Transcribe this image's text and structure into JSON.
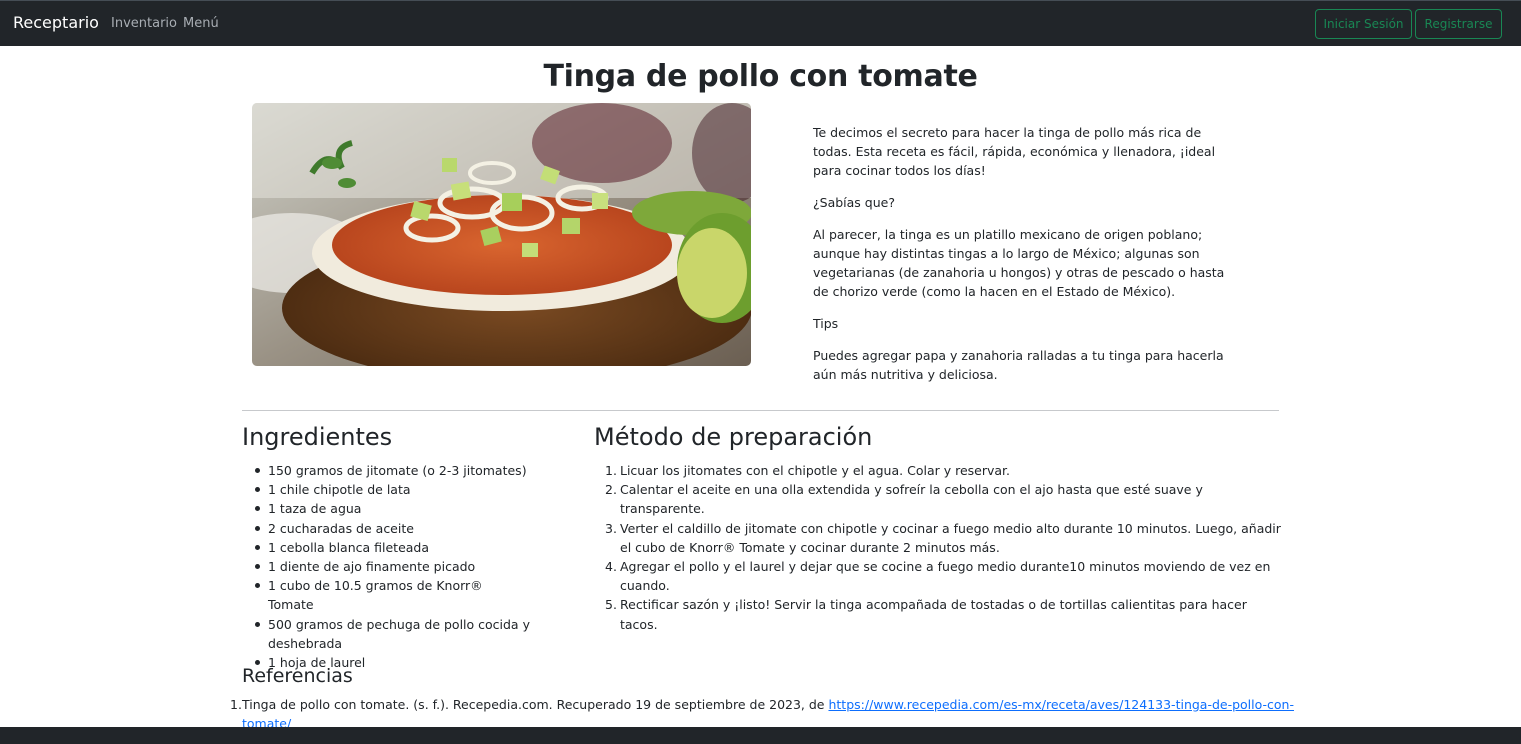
{
  "navbar": {
    "brand": "Receptario",
    "links": [
      "Inventario",
      "Menú"
    ],
    "login_label": "Iniciar Sesión",
    "register_label": "Registrarse"
  },
  "recipe": {
    "title": "Tinga de pollo con tomate",
    "intro": [
      "Te decimos el secreto para hacer la tinga de pollo más rica de todas. Esta receta es fácil, rápida, económica y llenadora, ¡ideal para cocinar todos los días!",
      "¿Sabías que?",
      "Al parecer, la tinga es un platillo mexicano de origen poblano; aunque hay distintas tingas a lo largo de México; algunas son vegetarianas (de zanahoria u hongos) y otras de pescado o hasta de chorizo verde (como la hacen en el Estado de México).",
      "Tips",
      "Puedes agregar papa y zanahoria ralladas a tu tinga para hacerla aún más nutritiva y deliciosa."
    ],
    "ingredients_heading": "Ingredientes",
    "ingredients": [
      "150 gramos de jitomate (o 2-3 jitomates)",
      "1 chile chipotle de lata",
      "1 taza de agua",
      "2 cucharadas de aceite",
      "1 cebolla blanca fileteada",
      "1 diente de ajo finamente picado",
      "1 cubo de 10.5 gramos de Knorr® Tomate",
      "500 gramos de pechuga de pollo cocida y deshebrada",
      "1 hoja de laurel"
    ],
    "method_heading": "Método de preparación",
    "steps": [
      {
        "num": "1.",
        "text": "Licuar los jitomates con el chipotle y el agua. Colar y reservar."
      },
      {
        "num": "2.",
        "text": "Calentar el aceite en una olla extendida y sofreír la cebolla con el ajo hasta que esté suave y transparente."
      },
      {
        "num": "3.",
        "text": "Verter el caldillo de jitomate con chipotle y cocinar a fuego medio alto durante 10 minutos. Luego, añadir el cubo de Knorr® Tomate y cocinar durante 2 minutos más."
      },
      {
        "num": "4.",
        "text": "Agregar el pollo y el laurel y dejar que se cocine a fuego medio durante10 minutos moviendo de vez en cuando."
      },
      {
        "num": "5.",
        "text": "Rectificar sazón y ¡listo! Servir la tinga acompañada de tostadas o de tortillas calientitas para hacer tacos."
      }
    ],
    "references_heading": "Referencias",
    "reference": {
      "num": "1.",
      "text": "Tinga de pollo con tomate. (s. f.). Recepedia.com. Recuperado 19 de septiembre de 2023, de ",
      "link": "https://www.recepedia.com/es-mx/receta/aves/124133-tinga-de-pollo-con-tomate/"
    }
  },
  "colors": {
    "navbar_bg": "#212529",
    "success": "#198754",
    "link": "#0d6efd"
  }
}
